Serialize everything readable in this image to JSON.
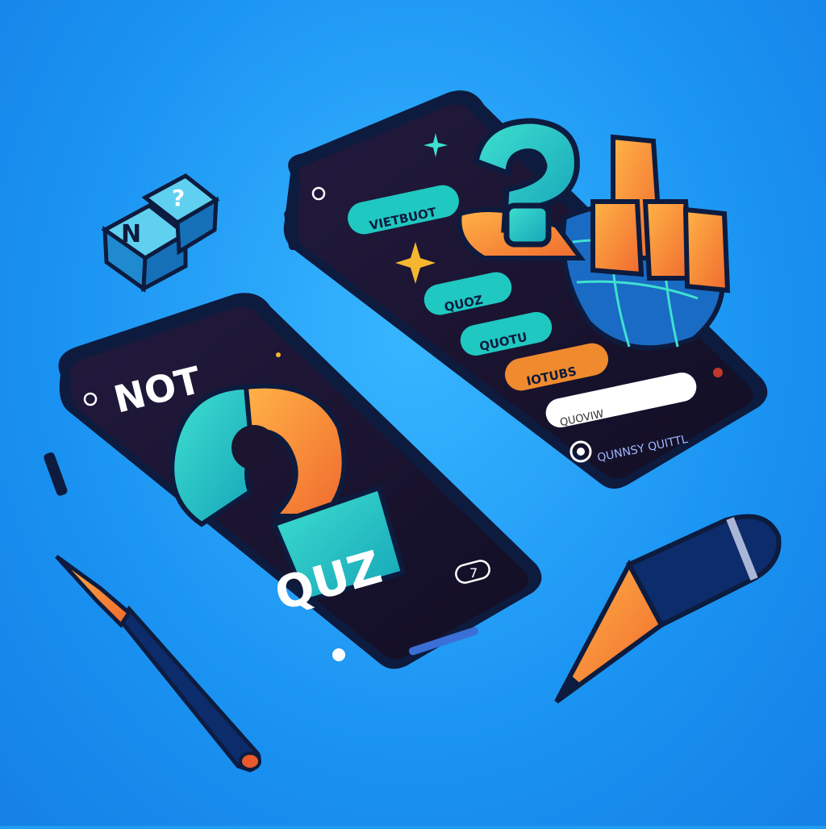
{
  "colors": {
    "background": "#1f9bf0",
    "teal": "#1fc8c0",
    "orange": "#f08a2e",
    "screen": "#1b1530",
    "phone_body": "#0d1b3e"
  },
  "left_phone": {
    "title_top": "NOT",
    "title_bottom": "QUZ",
    "corner_badge": "7"
  },
  "right_phone": {
    "menu_items": [
      {
        "label": "VIETBUOT",
        "color": "#1fc8c0"
      },
      {
        "label": "QUOZ",
        "color": "#1fc8c0"
      },
      {
        "label": "QUOTU",
        "color": "#1fc8c0"
      },
      {
        "label": "IOTUBS",
        "color": "#f08a2e"
      }
    ],
    "search_placeholder": "QUOVIW",
    "footer_text": "QUNNSY QUITTL"
  },
  "dice": {
    "front_glyph": "N",
    "top_glyph": "?"
  },
  "icons": [
    "question-mark-icon",
    "pointing-hand-icon",
    "globe-icon",
    "sparkle-icon",
    "pencil-icon",
    "pen-icon",
    "search-icon"
  ]
}
